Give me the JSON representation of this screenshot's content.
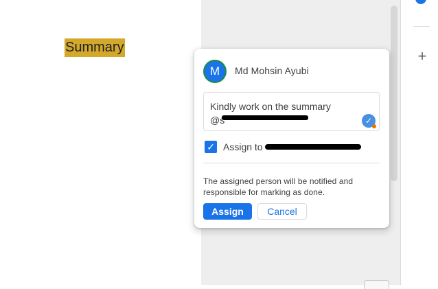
{
  "document": {
    "highlighted_text": "Summary"
  },
  "comment_card": {
    "avatar_initial": "M",
    "author_name": "Md Mohsin Ayubi",
    "comment_text": "Kindly work on the summary\n@s",
    "assign_label": "Assign to",
    "assign_checked": true,
    "info_text": "The assigned person will be notified and responsible for marking as done.",
    "assign_button": "Assign",
    "cancel_button": "Cancel"
  },
  "side_panel": {
    "add_icon": "+"
  },
  "icons": {
    "check": "check-icon",
    "add": "add-icon"
  },
  "colors": {
    "highlight": "#d4a82a",
    "accent": "#1a73e8",
    "avatar_ring": "#1e8e3e",
    "canvas_bg": "#eeeeee"
  }
}
